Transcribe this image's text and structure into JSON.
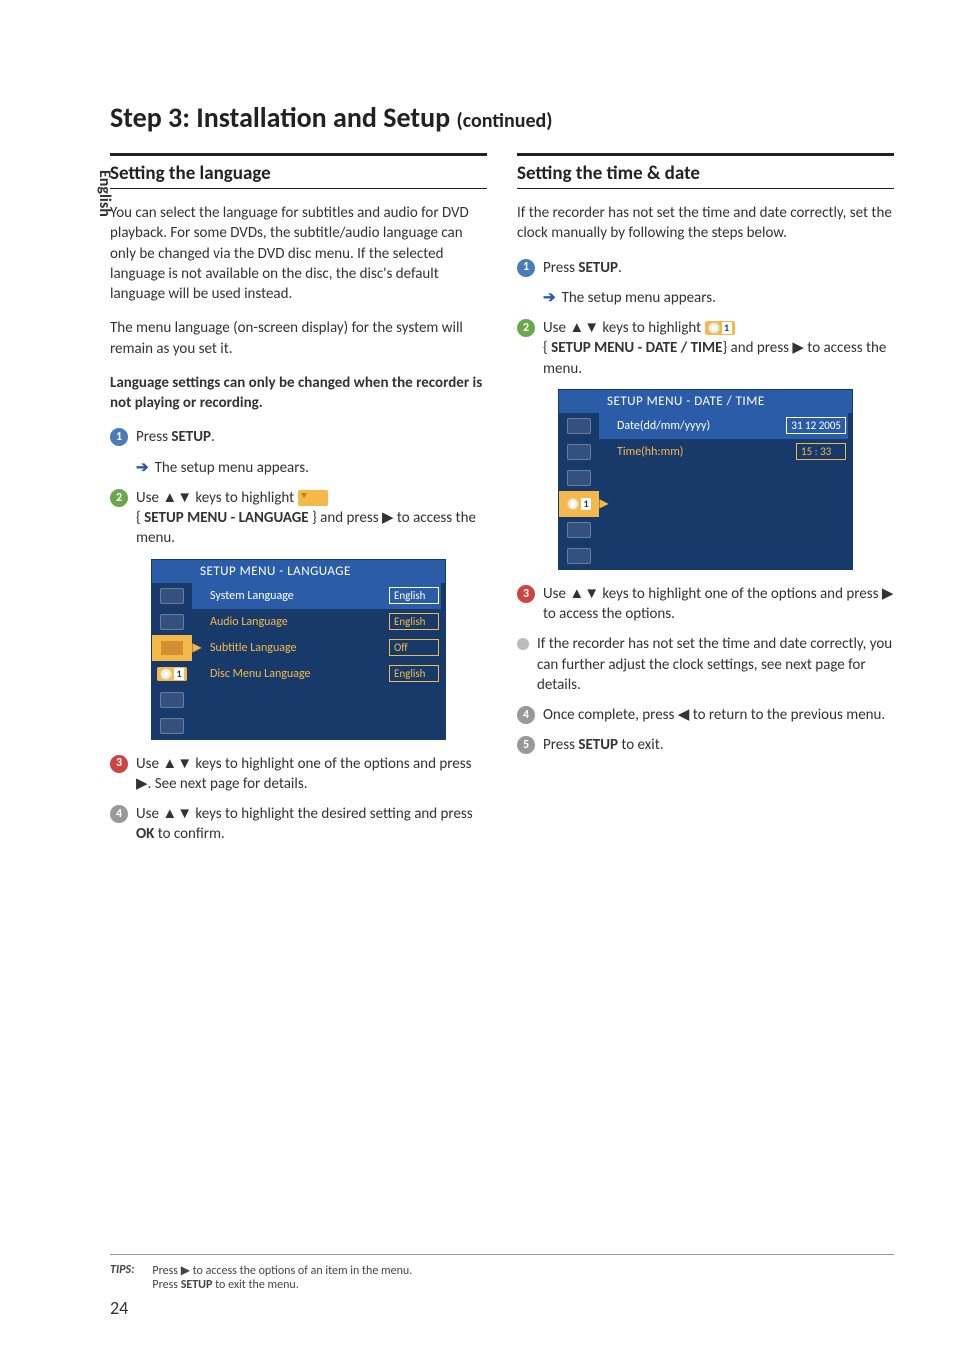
{
  "language_tab": "English",
  "page_title": "Step 3: Installation and Setup",
  "page_title_suffix": "(continued)",
  "left": {
    "heading": "Setting the language",
    "intro1": "You can select the language for subtitles and audio for DVD playback. For some DVDs, the subtitle/audio language can only be changed via the DVD disc menu. If the selected language is not available on the disc, the disc's default language will be used instead.",
    "intro2": "The menu language (on-screen display) for the system will remain as you set it.",
    "warning": "Language settings can only be changed when the recorder is not playing or recording.",
    "step1_a": "Press ",
    "step1_b": "SETUP",
    "step1_c": ".",
    "step1_sub": "The setup menu appears.",
    "step2_a": "Use ▲▼ keys to highlight ",
    "step2_b": "{ ",
    "step2_c": "SETUP MENU - LANGUAGE",
    "step2_d": " } and press ▶ to access the menu.",
    "menu_title": "SETUP MENU - LANGUAGE",
    "menu_rows": {
      "0": {
        "label": "System Language",
        "value": "English"
      },
      "1": {
        "label": "Audio Language",
        "value": "English"
      },
      "2": {
        "label": "Subtitle Language",
        "value": "Off"
      },
      "3": {
        "label": "Disc Menu Language",
        "value": "English"
      }
    },
    "step3": "Use ▲▼ keys to highlight one of the options and press ▶. See next page for details.",
    "step4_a": "Use ▲▼ keys to highlight the desired setting and press ",
    "step4_b": "OK",
    "step4_c": " to confirm."
  },
  "right": {
    "heading": "Setting the time & date",
    "intro": "If the recorder has not set the time and date correctly, set the clock manually by following the steps below.",
    "step1_a": "Press ",
    "step1_b": "SETUP",
    "step1_c": ".",
    "step1_sub": "The setup menu appears.",
    "step2_a": "Use ▲▼ keys to highlight ",
    "step2_b": "{ ",
    "step2_c": "SETUP MENU - DATE / TIME",
    "step2_d": "} and press ▶ to access the menu.",
    "menu_title": "SETUP MENU - DATE / TIME",
    "menu_rows": {
      "0": {
        "label": "Date(dd/mm/yyyy)",
        "value": "31 12 2005"
      },
      "1": {
        "label": "Time(hh:mm)",
        "value": "15 : 33"
      }
    },
    "step3": "Use ▲▼ keys to highlight one of the options and press ▶ to access the options.",
    "bullet": "If the recorder has not set the time and date correctly, you can further adjust the clock settings, see next page for details.",
    "step4": "Once complete, press ◀ to return to the previous menu.",
    "step5_a": "Press ",
    "step5_b": "SETUP",
    "step5_c": " to exit."
  },
  "tips": {
    "label": "TIPS:",
    "line1_a": "Press ▶ to access the options of an item in the menu.",
    "line2_a": "Press ",
    "line2_b": "SETUP",
    "line2_c": " to exit the menu."
  },
  "page_number": "24",
  "chart_data": null
}
